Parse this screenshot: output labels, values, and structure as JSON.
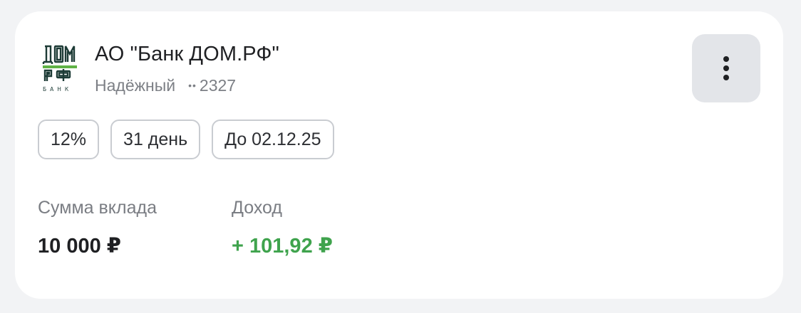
{
  "bank": {
    "name": "АО \"Банк ДОМ.РФ\"",
    "status": "Надёжный",
    "account_dots": "••",
    "account_suffix": "2327",
    "logo_text": "ДОМ РФ БАНК"
  },
  "chips": {
    "rate": "12%",
    "term": "31 день",
    "until": "До 02.12.25"
  },
  "deposit": {
    "sum_label": "Сумма вклада",
    "sum_value": "10 000 ₽",
    "income_label": "Доход",
    "income_value": "+ 101,92 ₽"
  },
  "colors": {
    "background": "#f2f3f5",
    "card": "#ffffff",
    "income": "#3fa34d",
    "logo_dark": "#1d3b36",
    "logo_green": "#5fb245",
    "menu_button": "#e3e5e9"
  },
  "icons": {
    "menu": "more-vertical-icon",
    "logo": "dom-rf-bank-logo"
  }
}
